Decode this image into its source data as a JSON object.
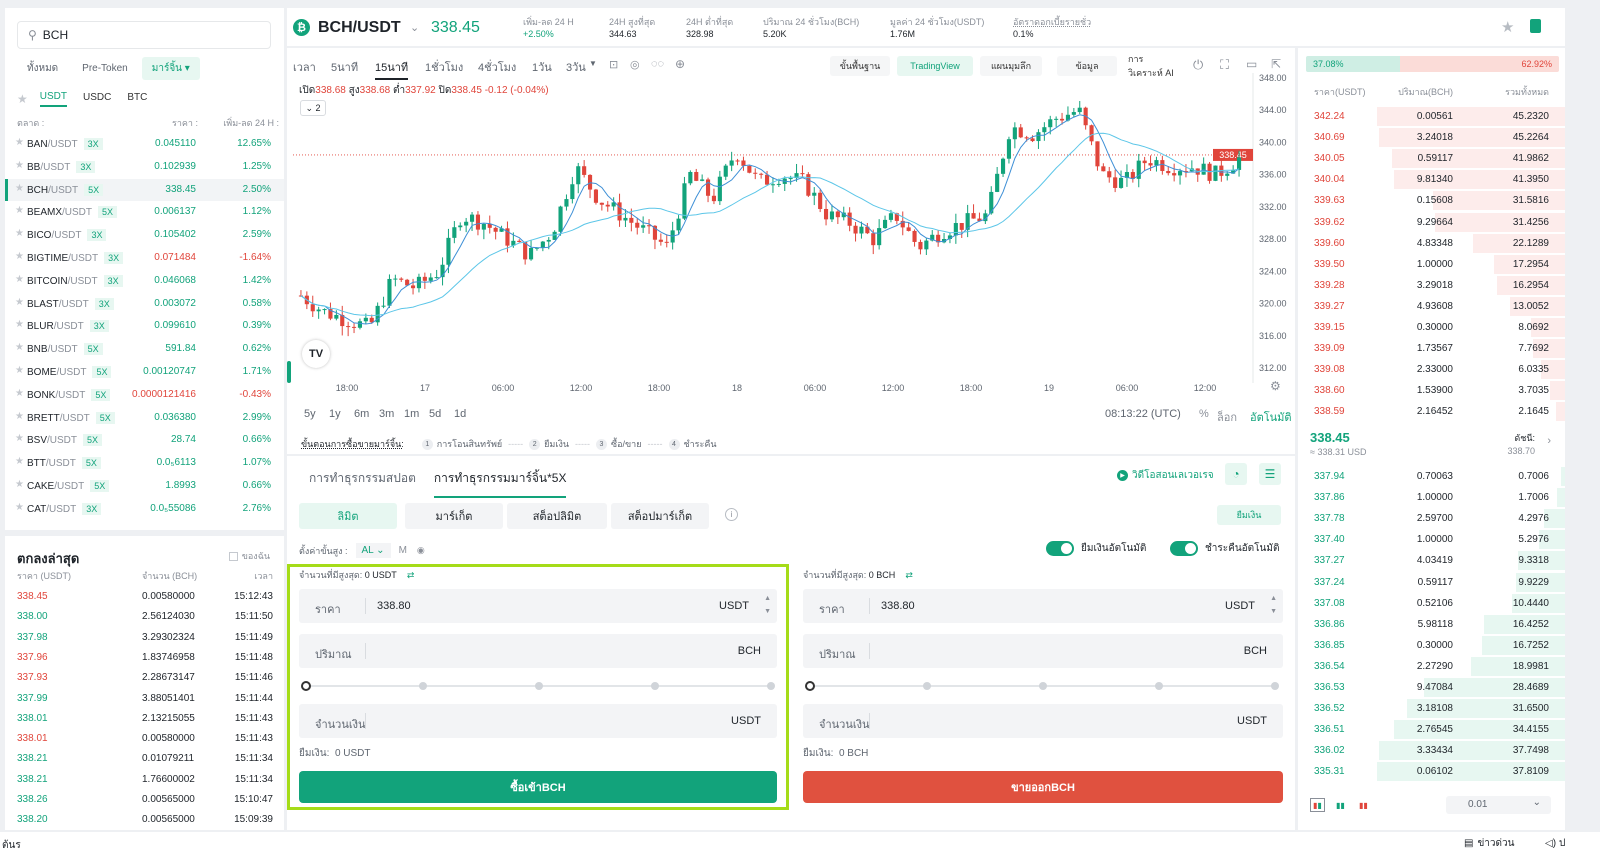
{
  "search": {
    "value": "BCH"
  },
  "filter_tabs": [
    "ทั้งหมด",
    "Pre-Token",
    "มาร์จิ้น"
  ],
  "quote_tabs": [
    "USDT",
    "USDC",
    "BTC"
  ],
  "market_header": {
    "market": "ตลาด :",
    "price": "ราคา :",
    "change": "เพิ่ม-ลด 24 H :"
  },
  "markets": [
    {
      "base": "BAN",
      "quote": "/USDT",
      "lev": "3X",
      "price": "0.045110",
      "change": "12.65%",
      "up": true
    },
    {
      "base": "BB",
      "quote": "/USDT",
      "lev": "3X",
      "price": "0.102939",
      "change": "1.25%",
      "up": true
    },
    {
      "base": "BCH",
      "quote": "/USDT",
      "lev": "5X",
      "price": "338.45",
      "change": "2.50%",
      "up": true
    },
    {
      "base": "BEAMX",
      "quote": "/USDT",
      "lev": "5X",
      "price": "0.006137",
      "change": "1.12%",
      "up": true
    },
    {
      "base": "BICO",
      "quote": "/USDT",
      "lev": "3X",
      "price": "0.105402",
      "change": "2.59%",
      "up": true
    },
    {
      "base": "BIGTIME",
      "quote": "/USDT",
      "lev": "3X",
      "price": "0.071484",
      "change": "-1.64%",
      "up": false
    },
    {
      "base": "BITCOIN",
      "quote": "/USDT",
      "lev": "3X",
      "price": "0.046068",
      "change": "1.42%",
      "up": true
    },
    {
      "base": "BLAST",
      "quote": "/USDT",
      "lev": "3X",
      "price": "0.003072",
      "change": "0.58%",
      "up": true
    },
    {
      "base": "BLUR",
      "quote": "/USDT",
      "lev": "3X",
      "price": "0.099610",
      "change": "0.39%",
      "up": true
    },
    {
      "base": "BNB",
      "quote": "/USDT",
      "lev": "5X",
      "price": "591.84",
      "change": "0.62%",
      "up": true
    },
    {
      "base": "BOME",
      "quote": "/USDT",
      "lev": "5X",
      "price": "0.00120747",
      "change": "1.71%",
      "up": true
    },
    {
      "base": "BONK",
      "quote": "/USDT",
      "lev": "5X",
      "price": "0.0000121416",
      "change": "-0.43%",
      "up": false
    },
    {
      "base": "BRETT",
      "quote": "/USDT",
      "lev": "5X",
      "price": "0.036380",
      "change": "2.99%",
      "up": true
    },
    {
      "base": "BSV",
      "quote": "/USDT",
      "lev": "5X",
      "price": "28.74",
      "change": "0.66%",
      "up": true
    },
    {
      "base": "BTT",
      "quote": "/USDT",
      "lev": "5X",
      "price": "0.0₅6113",
      "change": "1.07%",
      "up": true
    },
    {
      "base": "CAKE",
      "quote": "/USDT",
      "lev": "5X",
      "price": "1.8993",
      "change": "0.66%",
      "up": true
    },
    {
      "base": "CAT",
      "quote": "/USDT",
      "lev": "3X",
      "price": "0.0₅55086",
      "change": "2.76%",
      "up": true
    }
  ],
  "trades": {
    "title": "ตกลงล่าสุด",
    "mine_label": "ของฉัน",
    "headers": [
      "ราคา (USDT)",
      "จำนวน (BCH)",
      "เวลา"
    ],
    "rows": [
      {
        "price": "338.45",
        "amount": "0.00580000",
        "time": "15:12:43",
        "up": false
      },
      {
        "price": "338.00",
        "amount": "2.56124030",
        "time": "15:11:50",
        "up": true
      },
      {
        "price": "337.98",
        "amount": "3.29302324",
        "time": "15:11:49",
        "up": true
      },
      {
        "price": "337.96",
        "amount": "1.83746958",
        "time": "15:11:48",
        "up": false
      },
      {
        "price": "337.93",
        "amount": "2.28673147",
        "time": "15:11:46",
        "up": false
      },
      {
        "price": "337.99",
        "amount": "3.88051401",
        "time": "15:11:44",
        "up": true
      },
      {
        "price": "338.01",
        "amount": "2.13215055",
        "time": "15:11:43",
        "up": true
      },
      {
        "price": "338.01",
        "amount": "0.00580000",
        "time": "15:11:43",
        "up": false
      },
      {
        "price": "338.21",
        "amount": "0.01079211",
        "time": "15:11:34",
        "up": true
      },
      {
        "price": "338.21",
        "amount": "1.76600002",
        "time": "15:11:34",
        "up": true
      },
      {
        "price": "338.26",
        "amount": "0.00565000",
        "time": "15:10:47",
        "up": true
      },
      {
        "price": "338.20",
        "amount": "0.00565000",
        "time": "15:09:39",
        "up": true
      }
    ]
  },
  "header": {
    "pair": "BCH/USDT",
    "price": "338.45",
    "stats": [
      {
        "label": "เพิ่ม-ลด 24 H",
        "value": "+2.50%",
        "green": true
      },
      {
        "label": "24H สูงที่สุด",
        "value": "344.63",
        "green": false
      },
      {
        "label": "24H ต่ำที่สุด",
        "value": "328.98",
        "green": false
      },
      {
        "label": "ปริมาณ 24 ชั่วโมง(BCH)",
        "value": "5.20K",
        "green": false
      },
      {
        "label": "มูลค่า 24 ชั่วโมง(USDT)",
        "value": "1.76M",
        "green": false
      },
      {
        "label": "อัตราดอกเบี้ยรายชั่ว",
        "value": "0.1%",
        "green": false
      }
    ]
  },
  "timeframes": [
    "เวลา",
    "5นาที",
    "15นาที",
    "1ชั่วโมง",
    "4ชั่วโมง",
    "1วัน",
    "3วัน"
  ],
  "chart_tools": [
    "ขั้นพื้นฐาน",
    "TradingView",
    "แผนมุมลึก",
    "ข้อมูล",
    "การวิเคราะห์ AI"
  ],
  "ohlc": {
    "open_label": "เปิด",
    "open": "338.68",
    "high_label": "สูง",
    "high": "338.68",
    "low_label": "ต่ำ",
    "low": "337.92",
    "close_label": "ปิด",
    "close": "338.45",
    "change": "-0.12 (-0.04%)",
    "indicator_toggle": "2"
  },
  "chart_data": {
    "type": "candlestick",
    "ylim": [
      312,
      348
    ],
    "y_ticks": [
      "348.00",
      "344.00",
      "340.00",
      "336.00",
      "332.00",
      "328.00",
      "324.00",
      "320.00",
      "316.00",
      "312.00"
    ],
    "x_ticks": [
      "18:00",
      "17",
      "06:00",
      "12:00",
      "18:00",
      "18",
      "06:00",
      "12:00",
      "18:00",
      "19",
      "06:00",
      "12:00"
    ],
    "last_price": "338.45",
    "approx_close_series": [
      321,
      319,
      318,
      317,
      323,
      322,
      324,
      331,
      330,
      328,
      326,
      329,
      337,
      333,
      331,
      329,
      327,
      336,
      333,
      339,
      335,
      336,
      335,
      331,
      330,
      328,
      331,
      327,
      329,
      330,
      331,
      342,
      341,
      343,
      344,
      336,
      335,
      338,
      337,
      337,
      336,
      338
    ]
  },
  "ranges": [
    "5y",
    "1y",
    "6m",
    "3m",
    "1m",
    "5d",
    "1d"
  ],
  "chart_footer": {
    "clock": "08:13:22 (UTC)",
    "pct": "%",
    "log": "ล็อก",
    "auto": "อัตโนมัติ"
  },
  "steps": {
    "label": "ขั้นตอนการซื้อขายมาร์จิ้น:",
    "items": [
      "การโอนสินทรัพย์",
      "ยืมเงิน",
      "ซื้อ/ขาย",
      "ชำระคืน"
    ]
  },
  "order": {
    "tabs": [
      "การทำธุรกรรมสปอต",
      "การทำธุรกรรมมาร์จิ้น*5X"
    ],
    "tutorial": "วิดีโอสอนเลเวอเรจ",
    "types": [
      "ลิมิต",
      "มาร์เก็ต",
      "สต็อปลิมิต",
      "สต็อปมาร์เก็ต"
    ],
    "borrow_button": "ยืมเงิน",
    "level_label": "ตั้งค่าขั้นสูง :",
    "level_value": "AL",
    "level_m": "M",
    "auto_borrow": "ยืมเงินอัตโนมัติ",
    "auto_repay": "ชำระคืนอัตโนมัติ",
    "buy": {
      "max_label": "จำนวนที่มีสูงสุด:",
      "max_value": "0 USDT",
      "price_label": "ราคา",
      "price": "338.80",
      "price_unit": "USDT",
      "qty_label": "ปริมาณ",
      "qty_unit": "BCH",
      "total_label": "จำนวนเงิน",
      "total_unit": "USDT",
      "borrow_label": "ยืมเงิน:",
      "borrow_value": "0 USDT",
      "button": "ซื้อเข้าBCH"
    },
    "sell": {
      "max_label": "จำนวนที่มีสูงสุด:",
      "max_value": "0 BCH",
      "price_label": "ราคา",
      "price": "338.80",
      "price_unit": "USDT",
      "qty_label": "ปริมาณ",
      "qty_unit": "BCH",
      "total_label": "จำนวนเงิน",
      "total_unit": "USDT",
      "borrow_label": "ยืมเงิน:",
      "borrow_value": "0 BCH",
      "button": "ขายออกBCH"
    }
  },
  "book": {
    "buy_ratio": "37.08%",
    "sell_ratio": "62.92%",
    "headers": [
      "ราคา(USDT)",
      "ปริมาณ(BCH)",
      "รวมทั้งหมด"
    ],
    "asks": [
      {
        "price": "342.24",
        "amount": "0.00561",
        "total": "45.2320",
        "depth": 1.0
      },
      {
        "price": "340.69",
        "amount": "3.24018",
        "total": "45.2264",
        "depth": 0.99
      },
      {
        "price": "340.05",
        "amount": "0.59117",
        "total": "41.9862",
        "depth": 0.92
      },
      {
        "price": "340.04",
        "amount": "9.81340",
        "total": "41.3950",
        "depth": 0.91
      },
      {
        "price": "339.63",
        "amount": "0.15608",
        "total": "31.5816",
        "depth": 0.7
      },
      {
        "price": "339.62",
        "amount": "9.29664",
        "total": "31.4256",
        "depth": 0.69
      },
      {
        "price": "339.60",
        "amount": "4.83348",
        "total": "22.1289",
        "depth": 0.49
      },
      {
        "price": "339.50",
        "amount": "1.00000",
        "total": "17.2954",
        "depth": 0.38
      },
      {
        "price": "339.28",
        "amount": "3.29018",
        "total": "16.2954",
        "depth": 0.36
      },
      {
        "price": "339.27",
        "amount": "4.93608",
        "total": "13.0052",
        "depth": 0.29
      },
      {
        "price": "339.15",
        "amount": "0.30000",
        "total": "8.0692",
        "depth": 0.18
      },
      {
        "price": "339.09",
        "amount": "1.73567",
        "total": "7.7692",
        "depth": 0.17
      },
      {
        "price": "339.08",
        "amount": "2.33000",
        "total": "6.0335",
        "depth": 0.13
      },
      {
        "price": "338.60",
        "amount": "1.53900",
        "total": "3.7035",
        "depth": 0.08
      },
      {
        "price": "338.59",
        "amount": "2.16452",
        "total": "2.1645",
        "depth": 0.05
      }
    ],
    "last_price": "338.45",
    "usd_price": "≈ 338.31 USD",
    "index_label": "ดัชนี:",
    "index_value": "338.70",
    "bids": [
      {
        "price": "337.94",
        "amount": "0.70063",
        "total": "0.7006",
        "depth": 0.02
      },
      {
        "price": "337.86",
        "amount": "1.00000",
        "total": "1.7006",
        "depth": 0.04
      },
      {
        "price": "337.78",
        "amount": "2.59700",
        "total": "4.2976",
        "depth": 0.11
      },
      {
        "price": "337.40",
        "amount": "1.00000",
        "total": "5.2976",
        "depth": 0.14
      },
      {
        "price": "337.27",
        "amount": "4.03419",
        "total": "9.3318",
        "depth": 0.25
      },
      {
        "price": "337.24",
        "amount": "0.59117",
        "total": "9.9229",
        "depth": 0.26
      },
      {
        "price": "337.08",
        "amount": "0.52106",
        "total": "10.4440",
        "depth": 0.28
      },
      {
        "price": "336.86",
        "amount": "5.98118",
        "total": "16.4252",
        "depth": 0.43
      },
      {
        "price": "336.85",
        "amount": "0.30000",
        "total": "16.7252",
        "depth": 0.44
      },
      {
        "price": "336.54",
        "amount": "2.27290",
        "total": "18.9981",
        "depth": 0.5
      },
      {
        "price": "336.53",
        "amount": "9.47084",
        "total": "28.4689",
        "depth": 0.75
      },
      {
        "price": "336.52",
        "amount": "3.18108",
        "total": "31.6500",
        "depth": 0.84
      },
      {
        "price": "336.51",
        "amount": "2.76545",
        "total": "34.4155",
        "depth": 0.91
      },
      {
        "price": "336.02",
        "amount": "3.33434",
        "total": "37.7498",
        "depth": 0.99
      },
      {
        "price": "335.31",
        "amount": "0.06102",
        "total": "37.8109",
        "depth": 1.0
      }
    ],
    "precision": "0.01"
  },
  "status_bar": {
    "left": "ต้นร",
    "news": "ข่าวด่วน",
    "right": "ป"
  }
}
